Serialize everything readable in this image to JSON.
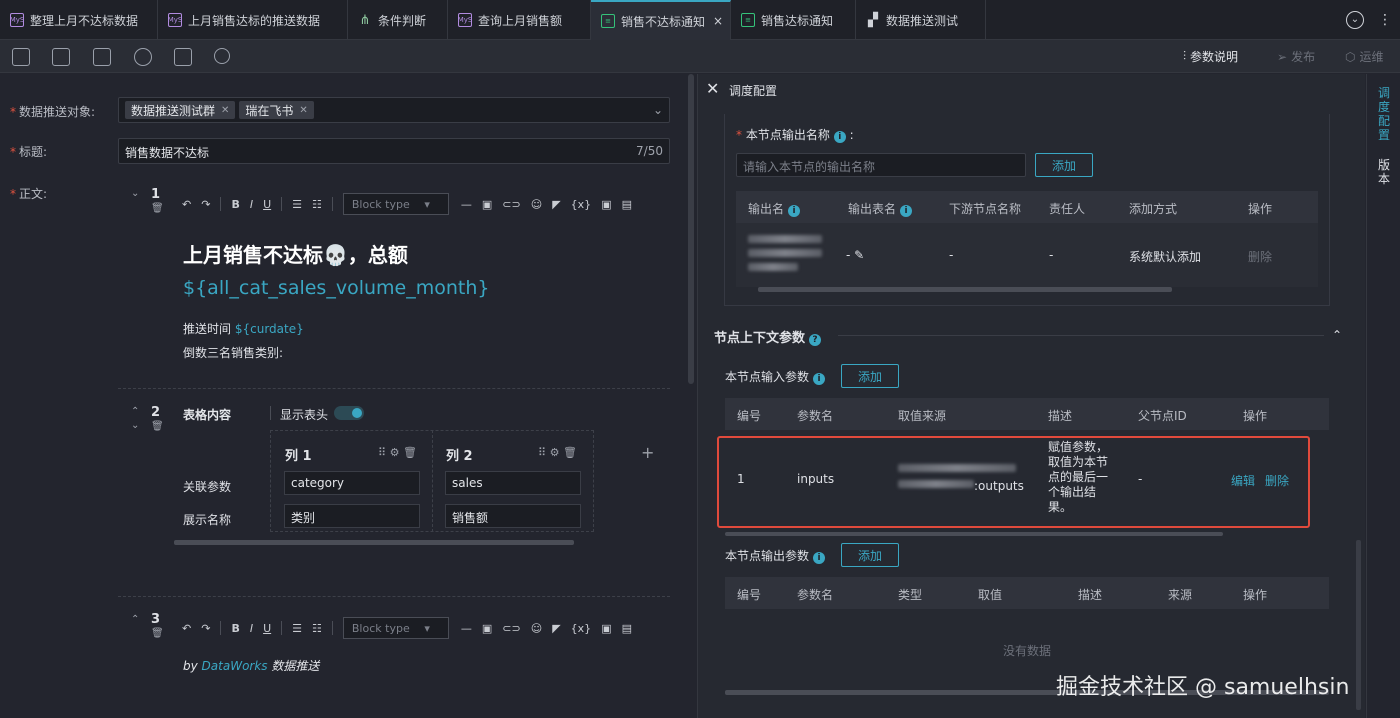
{
  "tabs": [
    {
      "label": "整理上月不达标数据",
      "icon": "mysql-icon"
    },
    {
      "label": "上月销售达标的推送数据",
      "icon": "mysql-icon"
    },
    {
      "label": "条件判断",
      "icon": "branch-icon"
    },
    {
      "label": "查询上月销售额",
      "icon": "mysql-icon"
    },
    {
      "label": "销售不达标通知",
      "icon": "notify-icon",
      "active": true
    },
    {
      "label": "销售达标通知",
      "icon": "notify-icon"
    },
    {
      "label": "数据推送测试",
      "icon": "flow-icon"
    }
  ],
  "tab_close": "×",
  "toolbar": {
    "params_label": "参数说明",
    "publish_label": "发布",
    "ops_label": "运维"
  },
  "form": {
    "target_label": "数据推送对象:",
    "target_chips": [
      "数据推送测试群",
      "瑞在飞书"
    ],
    "title_label": "标题:",
    "title_value": "销售数据不达标",
    "title_count": "7/50",
    "body_label": "正文:"
  },
  "editor": {
    "block_type_placeholder": "Block type",
    "var_token": "{x}",
    "block1": {
      "num": "1",
      "heading": "上月销售不达标💀，总额",
      "variable": "${all_cat_sales_volume_month}",
      "push_time_label": "推送时间",
      "push_time_var": "${curdate}",
      "bottom_label": "倒数三名销售类别:"
    },
    "block2": {
      "num": "2",
      "title": "表格内容",
      "show_header_label": "显示表头",
      "col1": "列 1",
      "col2": "列 2",
      "row1_label": "关联参数",
      "row2_label": "展示名称",
      "c11": "category",
      "c12": "sales",
      "c21": "类别",
      "c22": "销售额"
    },
    "block3": {
      "num": "3",
      "text_prefix": "by",
      "text_brand": "DataWorks",
      "text_suffix": "数据推送"
    }
  },
  "panel": {
    "title": "调度配置",
    "output_name_label": "本节点输出名称",
    "output_name_placeholder": "请输入本节点的输出名称",
    "add_label": "添加",
    "out_headers": [
      "输出名",
      "输出表名",
      "下游节点名称",
      "责任人",
      "添加方式",
      "操作"
    ],
    "out_row": {
      "table_name": "-",
      "downstream": "-",
      "owner": "-",
      "method": "系统默认添加",
      "op": "删除"
    },
    "context_title": "节点上下文参数",
    "input_title": "本节点输入参数",
    "in_headers": [
      "编号",
      "参数名",
      "取值来源",
      "描述",
      "父节点ID",
      "操作"
    ],
    "in_row": {
      "no": "1",
      "name": "inputs",
      "source_suffix": ":outputs",
      "desc": "赋值参数，取值为本节点的最后一个输出结果。",
      "parent": "-",
      "edit": "编辑",
      "del": "删除"
    },
    "output_params_title": "本节点输出参数",
    "outp_headers": [
      "编号",
      "参数名",
      "类型",
      "取值",
      "描述",
      "来源",
      "操作"
    ],
    "empty": "没有数据"
  },
  "sidebar": {
    "tab1": "调度配置",
    "tab2": "版本"
  },
  "watermark": "掘金技术社区 @ samuelhsin"
}
